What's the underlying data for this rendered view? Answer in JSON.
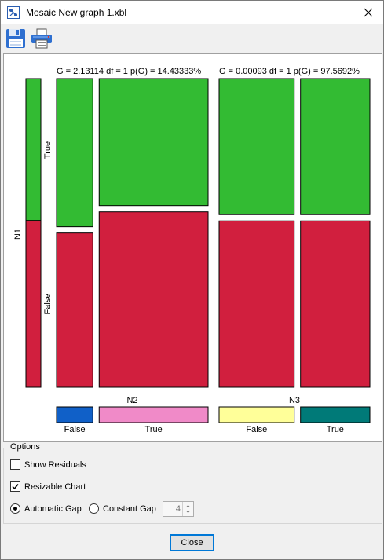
{
  "window": {
    "title": "Mosaic New graph 1.xbl"
  },
  "toolbar": {
    "save_icon": "floppy-disk-icon",
    "print_icon": "printer-icon"
  },
  "chart_data": {
    "type": "mosaic",
    "row_variable": "N1",
    "row_levels": [
      "True",
      "False"
    ],
    "row_marginal_true_share": 0.46,
    "column_variables": [
      {
        "name": "N2",
        "levels": [
          "False",
          "True"
        ],
        "level_colors": [
          "#1060c8",
          "#f08ac8"
        ],
        "level_share": [
          0.25,
          0.75
        ],
        "stat_label": "G = 2.13114 df = 1 p(G) = 14.43333%",
        "cells": [
          {
            "level": "False",
            "true_share": 0.49
          },
          {
            "level": "True",
            "true_share": 0.42
          }
        ]
      },
      {
        "name": "N3",
        "levels": [
          "False",
          "True"
        ],
        "level_colors": [
          "#ffff99",
          "#007a78"
        ],
        "level_share": [
          0.52,
          0.48
        ],
        "stat_label": "G = 0.00093 df = 1 p(G) = 97.5692%",
        "cells": [
          {
            "level": "False",
            "true_share": 0.45
          },
          {
            "level": "True",
            "true_share": 0.45
          }
        ]
      }
    ],
    "colors": {
      "true": "#33bb33",
      "false": "#d11f3e"
    }
  },
  "options": {
    "legend": "Options",
    "show_residuals": {
      "label": "Show Residuals",
      "checked": false
    },
    "resizable_chart": {
      "label": "Resizable Chart",
      "checked": true
    },
    "gap_mode": {
      "automatic_label": "Automatic Gap",
      "constant_label": "Constant Gap",
      "selected": "automatic"
    },
    "gap_value": "4"
  },
  "footer": {
    "close_label": "Close"
  }
}
